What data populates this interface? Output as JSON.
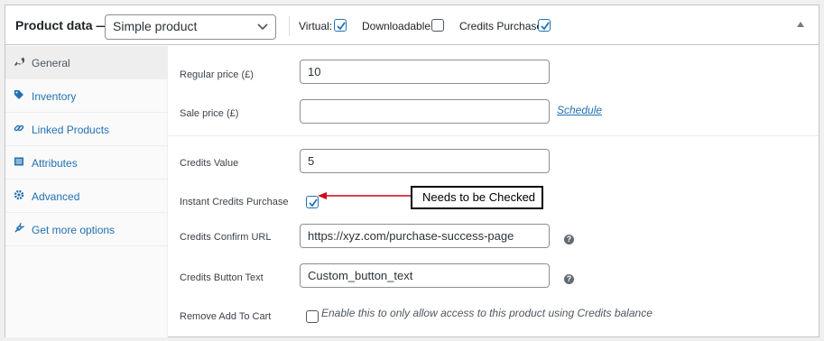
{
  "header": {
    "title": "Product data —",
    "product_type": "Simple product",
    "virtual_label": "Virtual:",
    "virtual_checked": true,
    "downloadable_label": "Downloadable:",
    "downloadable_checked": false,
    "credits_purchase_label": "Credits Purchase:",
    "credits_purchase_checked": true
  },
  "sidebar": {
    "items": [
      {
        "label": "General",
        "icon": "wrench-icon",
        "active": true
      },
      {
        "label": "Inventory",
        "icon": "tag-icon",
        "active": false
      },
      {
        "label": "Linked Products",
        "icon": "link-icon",
        "active": false
      },
      {
        "label": "Attributes",
        "icon": "list-icon",
        "active": false
      },
      {
        "label": "Advanced",
        "icon": "gear-icon",
        "active": false
      },
      {
        "label": "Get more options",
        "icon": "plugin-icon",
        "active": false
      }
    ]
  },
  "fields": {
    "regular_price": {
      "label": "Regular price (£)",
      "value": "10"
    },
    "sale_price": {
      "label": "Sale price (£)",
      "value": "",
      "link": "Schedule"
    },
    "credits_value": {
      "label": "Credits Value",
      "value": "5"
    },
    "instant_credits": {
      "label": "Instant Credits Purchase",
      "checked": true
    },
    "confirm_url": {
      "label": "Credits Confirm URL",
      "value": "https://xyz.com/purchase-success-page",
      "help_icon": "help-icon"
    },
    "button_text": {
      "label": "Credits Button Text",
      "value": "Custom_button_text",
      "help_icon": "help-icon"
    },
    "remove_add_to_cart": {
      "label": "Remove Add To Cart",
      "checked": false,
      "description": "Enable this to only allow access to this product using Credits balance"
    }
  },
  "annotation": {
    "text": "Needs to be Checked",
    "arrow_color": "#d0021b"
  },
  "colors": {
    "accent": "#2271b1",
    "border": "#c3c4c7"
  }
}
